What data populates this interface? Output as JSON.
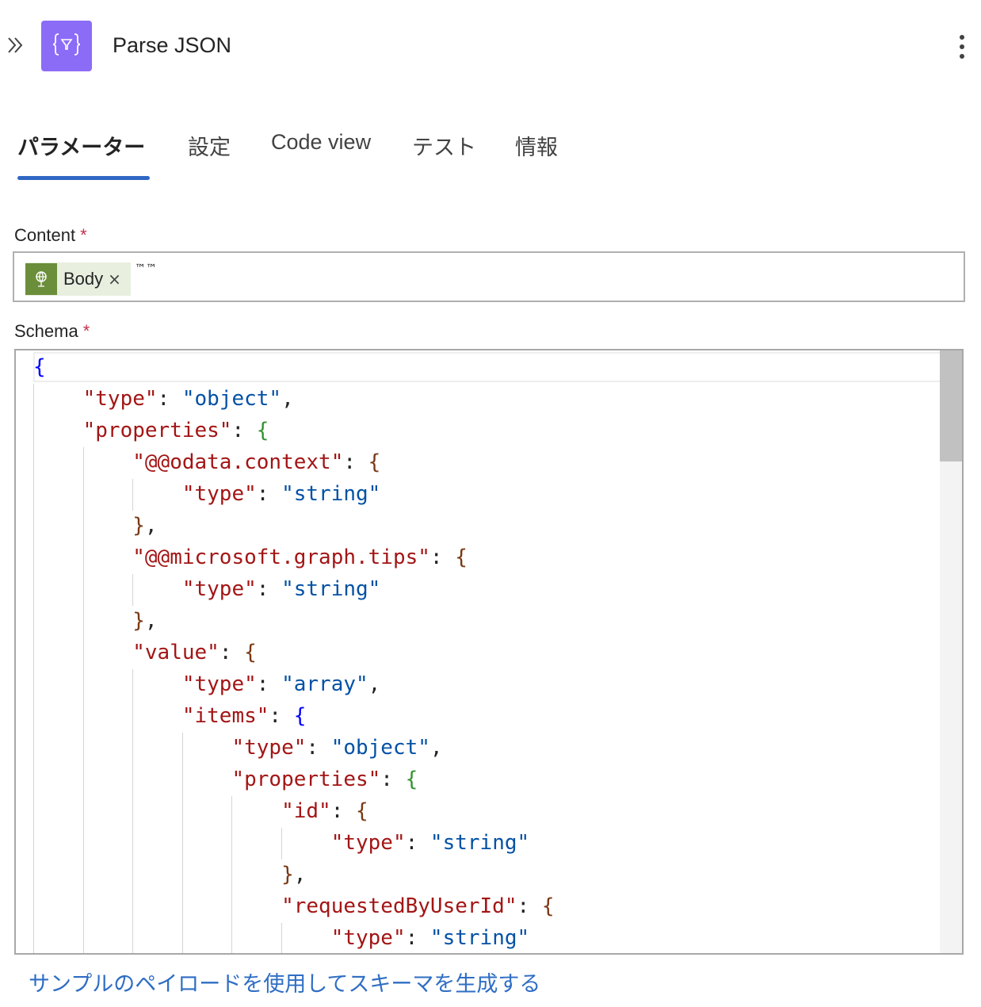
{
  "header": {
    "title": "Parse JSON",
    "icon": "json-braces-icon",
    "accent_color": "#8b6cf7"
  },
  "tabs": [
    {
      "label": "パラメーター",
      "active": true
    },
    {
      "label": "設定",
      "active": false
    },
    {
      "label": "Code view",
      "active": false
    },
    {
      "label": "テスト",
      "active": false
    },
    {
      "label": "情報",
      "active": false
    }
  ],
  "content_field": {
    "label": "Content",
    "required_mark": "*",
    "token_label": "Body",
    "token_remove": "×",
    "trailing_text": "™™",
    "token_color": "#6b8e3a"
  },
  "schema_field": {
    "label": "Schema",
    "required_mark": "*",
    "lines": [
      [
        {
          "t": "{",
          "c": "b1"
        }
      ],
      [
        {
          "t": "    "
        },
        {
          "t": "\"type\"",
          "c": "k"
        },
        {
          "t": ": ",
          "c": "p"
        },
        {
          "t": "\"object\"",
          "c": "v"
        },
        {
          "t": ",",
          "c": "p"
        }
      ],
      [
        {
          "t": "    "
        },
        {
          "t": "\"properties\"",
          "c": "k"
        },
        {
          "t": ": ",
          "c": "p"
        },
        {
          "t": "{",
          "c": "b2"
        }
      ],
      [
        {
          "t": "        "
        },
        {
          "t": "\"@@odata.context\"",
          "c": "k"
        },
        {
          "t": ": ",
          "c": "p"
        },
        {
          "t": "{",
          "c": "b3"
        }
      ],
      [
        {
          "t": "            "
        },
        {
          "t": "\"type\"",
          "c": "k"
        },
        {
          "t": ": ",
          "c": "p"
        },
        {
          "t": "\"string\"",
          "c": "v"
        }
      ],
      [
        {
          "t": "        "
        },
        {
          "t": "}",
          "c": "b3"
        },
        {
          "t": ",",
          "c": "p"
        }
      ],
      [
        {
          "t": "        "
        },
        {
          "t": "\"@@microsoft.graph.tips\"",
          "c": "k"
        },
        {
          "t": ": ",
          "c": "p"
        },
        {
          "t": "{",
          "c": "b3"
        }
      ],
      [
        {
          "t": "            "
        },
        {
          "t": "\"type\"",
          "c": "k"
        },
        {
          "t": ": ",
          "c": "p"
        },
        {
          "t": "\"string\"",
          "c": "v"
        }
      ],
      [
        {
          "t": "        "
        },
        {
          "t": "}",
          "c": "b3"
        },
        {
          "t": ",",
          "c": "p"
        }
      ],
      [
        {
          "t": "        "
        },
        {
          "t": "\"value\"",
          "c": "k"
        },
        {
          "t": ": ",
          "c": "p"
        },
        {
          "t": "{",
          "c": "b3"
        }
      ],
      [
        {
          "t": "            "
        },
        {
          "t": "\"type\"",
          "c": "k"
        },
        {
          "t": ": ",
          "c": "p"
        },
        {
          "t": "\"array\"",
          "c": "v"
        },
        {
          "t": ",",
          "c": "p"
        }
      ],
      [
        {
          "t": "            "
        },
        {
          "t": "\"items\"",
          "c": "k"
        },
        {
          "t": ": ",
          "c": "p"
        },
        {
          "t": "{",
          "c": "b1"
        }
      ],
      [
        {
          "t": "                "
        },
        {
          "t": "\"type\"",
          "c": "k"
        },
        {
          "t": ": ",
          "c": "p"
        },
        {
          "t": "\"object\"",
          "c": "v"
        },
        {
          "t": ",",
          "c": "p"
        }
      ],
      [
        {
          "t": "                "
        },
        {
          "t": "\"properties\"",
          "c": "k"
        },
        {
          "t": ": ",
          "c": "p"
        },
        {
          "t": "{",
          "c": "b2"
        }
      ],
      [
        {
          "t": "                    "
        },
        {
          "t": "\"id\"",
          "c": "k"
        },
        {
          "t": ": ",
          "c": "p"
        },
        {
          "t": "{",
          "c": "b3"
        }
      ],
      [
        {
          "t": "                        "
        },
        {
          "t": "\"type\"",
          "c": "k"
        },
        {
          "t": ": ",
          "c": "p"
        },
        {
          "t": "\"string\"",
          "c": "v"
        }
      ],
      [
        {
          "t": "                    "
        },
        {
          "t": "}",
          "c": "b3"
        },
        {
          "t": ",",
          "c": "p"
        }
      ],
      [
        {
          "t": "                    "
        },
        {
          "t": "\"requestedByUserId\"",
          "c": "k"
        },
        {
          "t": ": ",
          "c": "p"
        },
        {
          "t": "{",
          "c": "b3"
        }
      ],
      [
        {
          "t": "                        "
        },
        {
          "t": "\"type\"",
          "c": "k"
        },
        {
          "t": ": ",
          "c": "p"
        },
        {
          "t": "\"string\"",
          "c": "v"
        }
      ]
    ]
  },
  "generate_link": "サンプルのペイロードを使用してスキーマを生成する"
}
